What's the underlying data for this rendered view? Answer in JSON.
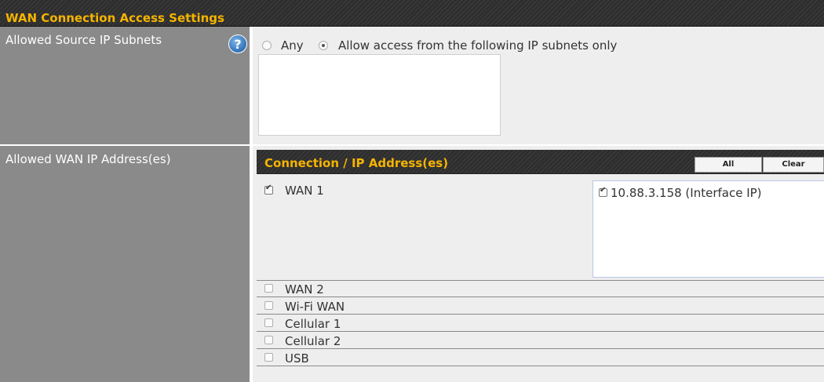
{
  "section": {
    "title": "WAN Connection Access Settings"
  },
  "source_subnets": {
    "label": "Allowed Source IP Subnets",
    "help_icon": "?",
    "option_any": "Any",
    "option_allow": "Allow access from the following IP subnets only",
    "selected": "allow",
    "subnets_value": ""
  },
  "wan_ips": {
    "label": "Allowed WAN IP Address(es)",
    "table_title": "Connection / IP Address(es)",
    "btn_all": "All",
    "btn_clear": "Clear",
    "rows": [
      {
        "name": "WAN 1",
        "checked": true,
        "ip": "10.88.3.158 (Interface IP)",
        "ip_checked": true
      },
      {
        "name": "WAN 2",
        "checked": false
      },
      {
        "name": "Wi-Fi WAN",
        "checked": false
      },
      {
        "name": "Cellular 1",
        "checked": false
      },
      {
        "name": "Cellular 2",
        "checked": false
      },
      {
        "name": "USB",
        "checked": false
      }
    ]
  },
  "colors": {
    "accent": "#f5b400",
    "label_bg": "#8a8a8a",
    "value_bg": "#eeeeee",
    "header_bg": "#2e2e2e"
  }
}
